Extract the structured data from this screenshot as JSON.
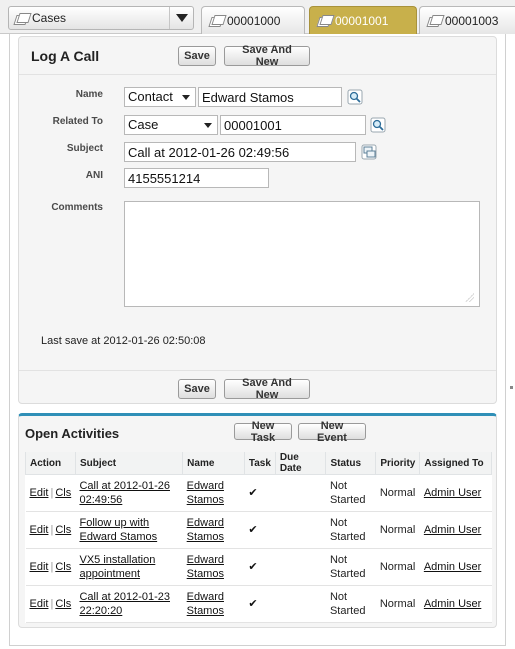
{
  "nav": {
    "object_label": "Cases",
    "menu_icon": "chevron-down-icon"
  },
  "tabs": [
    {
      "label": "00001000",
      "active": false
    },
    {
      "label": "00001001",
      "active": true
    },
    {
      "label": "00001003",
      "active": false
    }
  ],
  "colors": {
    "active_tab": "#c8b04b",
    "activities_accent": "#2f8fb7",
    "link": "#015ba7"
  },
  "log_call": {
    "title": "Log A Call",
    "save_label": "Save",
    "save_new_label": "Save And New",
    "fields": {
      "name_label": "Name",
      "name_type": "Contact",
      "name_value": "Edward Stamos",
      "related_label": "Related To",
      "related_type": "Case",
      "related_value": "00001001",
      "subject_label": "Subject",
      "subject_value": "Call at 2012-01-26 02:49:56",
      "ani_label": "ANI",
      "ani_value": "4155551214",
      "comments_label": "Comments",
      "comments_value": ""
    },
    "last_save": "Last save at 2012-01-26 02:50:08"
  },
  "open_activities": {
    "title": "Open Activities",
    "new_task_label": "New Task",
    "new_event_label": "New Event",
    "columns": [
      "Action",
      "Subject",
      "Name",
      "Task",
      "Due Date",
      "Status",
      "Priority",
      "Assigned To"
    ],
    "edit_label": "Edit",
    "cls_label": "Cls",
    "rows": [
      {
        "subject_1": "Call at 2012-01-26",
        "subject_2": "02:49:56",
        "name_1": "Edward",
        "name_2": "Stamos",
        "task": "✔",
        "due": "",
        "status_1": "Not",
        "status_2": "Started",
        "priority": "Normal",
        "assigned": "Admin User"
      },
      {
        "subject_1": "Follow up with",
        "subject_2": "Edward Stamos",
        "name_1": "Edward",
        "name_2": "Stamos",
        "task": "✔",
        "due": "",
        "status_1": "Not",
        "status_2": "Started",
        "priority": "Normal",
        "assigned": "Admin User"
      },
      {
        "subject_1": "VX5 installation",
        "subject_2": "appointment",
        "name_1": "Edward",
        "name_2": "Stamos",
        "task": "✔",
        "due": "",
        "status_1": "Not",
        "status_2": "Started",
        "priority": "Normal",
        "assigned": "Admin User"
      },
      {
        "subject_1": "Call at 2012-01-23",
        "subject_2": "22:20:20",
        "name_1": "Edward",
        "name_2": "Stamos",
        "task": "✔",
        "due": "",
        "status_1": "Not",
        "status_2": "Started",
        "priority": "Normal",
        "assigned": "Admin User"
      }
    ]
  }
}
